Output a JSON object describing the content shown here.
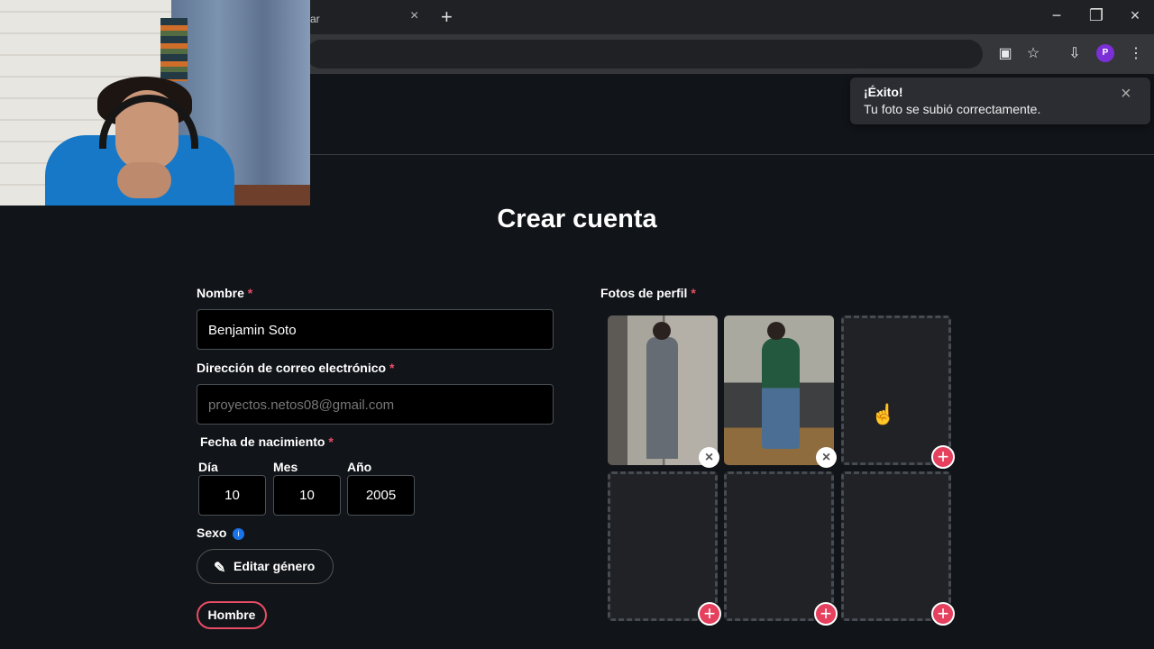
{
  "browser": {
    "tab_title": "ar",
    "tab_close": "×",
    "new_tab": "+",
    "minimize": "−",
    "restore": "❐",
    "close": "×",
    "profile_initial": "P"
  },
  "page": {
    "title": "Crear cuenta",
    "required_mark": "*"
  },
  "form": {
    "name": {
      "label": "Nombre",
      "value": "Benjamin Soto"
    },
    "email": {
      "label": "Dirección de correo electrónico",
      "placeholder": "proyectos.netos08@gmail.com"
    },
    "birth": {
      "label": "Fecha de nacimiento",
      "day_label": "Día",
      "day_value": "10",
      "month_label": "Mes",
      "month_value": "10",
      "year_label": "Año",
      "year_value": "2005"
    },
    "sex": {
      "label": "Sexo",
      "edit_button": "Editar género",
      "selected": "Hombre"
    },
    "photos": {
      "label": "Fotos de perfil"
    }
  },
  "toast": {
    "title": "¡Éxito!",
    "message": "Tu foto se subió correctamente.",
    "close": "×"
  },
  "icons": {
    "remove": "×",
    "add": "+",
    "info": "i",
    "pencil": "✎",
    "cursor": "☝"
  }
}
